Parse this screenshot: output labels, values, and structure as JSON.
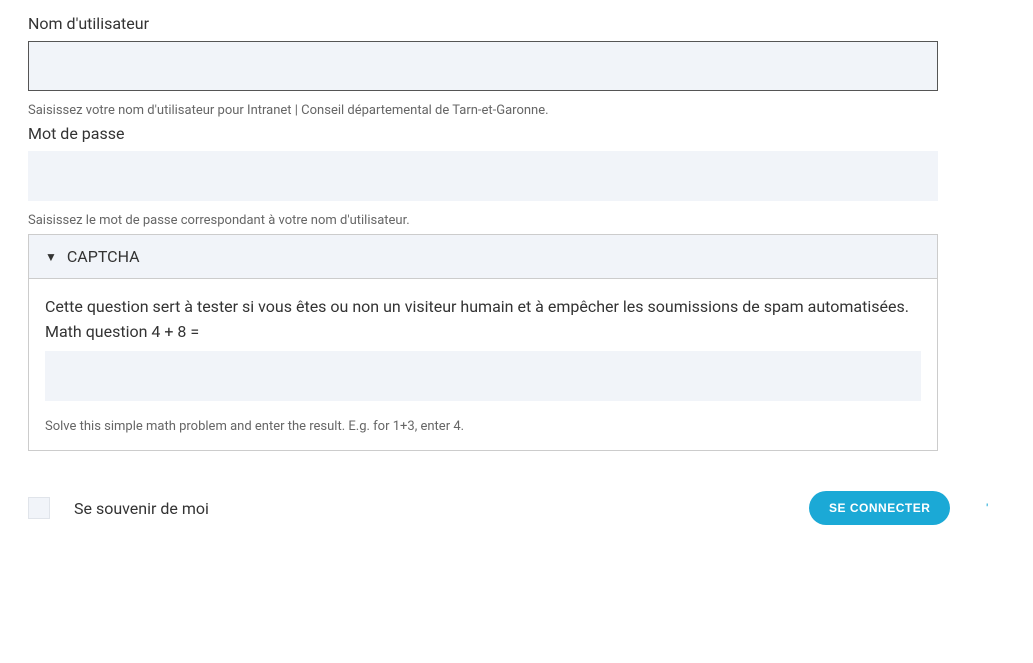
{
  "username": {
    "label": "Nom d'utilisateur",
    "value": "",
    "hint": "Saisissez votre nom d'utilisateur pour Intranet | Conseil départemental de Tarn-et-Garonne."
  },
  "password": {
    "label": "Mot de passe",
    "value": "",
    "hint": "Saisissez le mot de passe correspondant à votre nom d'utilisateur."
  },
  "captcha": {
    "caret": "▼",
    "title": "CAPTCHA",
    "description": "Cette question sert à tester si vous êtes ou non un visiteur humain et à empêcher les soumissions de spam automatisées.",
    "question": "Math question 4 + 8 =",
    "value": "",
    "hint": "Solve this simple math problem and enter the result. E.g. for 1+3, enter 4."
  },
  "remember": {
    "label": "Se souvenir de moi",
    "checked": false
  },
  "submit": {
    "label": "SE CONNECTER"
  },
  "tick": "'"
}
